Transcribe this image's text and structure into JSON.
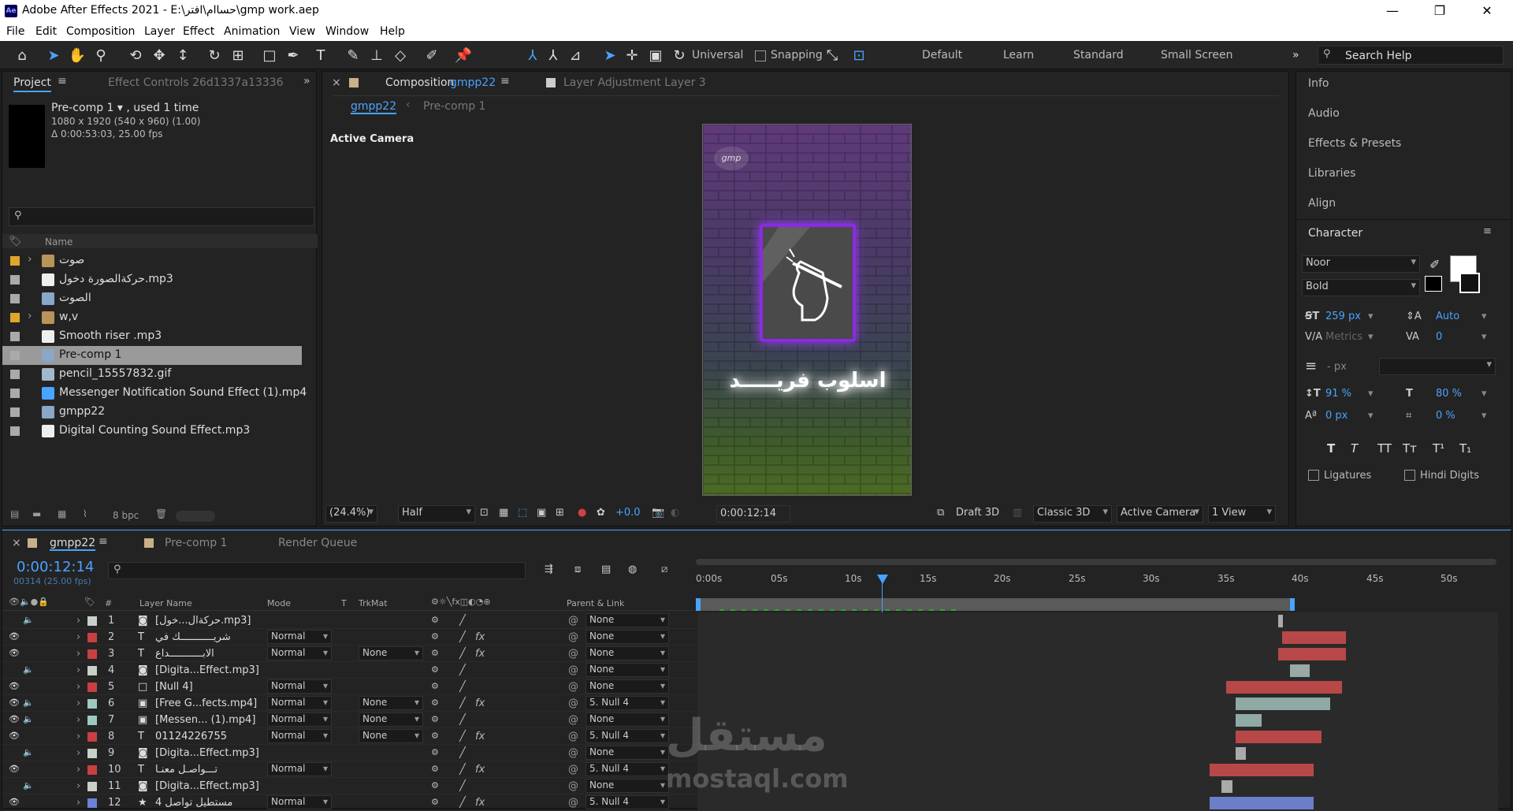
{
  "titlebar": {
    "app_icon": "Ae",
    "title": "Adobe After Effects 2021 - E:\\حساام\\افتر\\gmp work.aep",
    "minimize": "—",
    "maximize": "❐",
    "close": "✕"
  },
  "menu": [
    "File",
    "Edit",
    "Composition",
    "Layer",
    "Effect",
    "Animation",
    "View",
    "Window",
    "Help"
  ],
  "toolbar": {
    "axis_mode": "Universal",
    "snapping": "Snapping",
    "workspaces": [
      "Default",
      "Learn",
      "Standard",
      "Small Screen"
    ],
    "search_placeholder": "Search Help"
  },
  "project": {
    "tab": "Project",
    "effect_tab": "Effect Controls 26d1337a13336",
    "preview_name": "Pre-comp 1 ▾ , used 1 time",
    "preview_info1": "1080 x 1920  (540 x 960) (1.00)",
    "preview_info2": "Δ 0:00:53:03, 25.00 fps",
    "col_name": "Name",
    "bpc": "8 bpc",
    "items": [
      {
        "name": "صوت",
        "type": "folder",
        "color": "#e0a52a"
      },
      {
        "name": "حركةالصورة دخول.mp3",
        "type": "audio",
        "color": "#aaaaaa"
      },
      {
        "name": "الصوت",
        "type": "comp",
        "color": "#aaaaaa"
      },
      {
        "name": "w,v",
        "type": "folder",
        "color": "#e0a52a"
      },
      {
        "name": "Smooth riser .mp3",
        "type": "audio",
        "color": "#aaaaaa"
      },
      {
        "name": "Pre-comp 1",
        "type": "comp",
        "color": "#aaaaaa"
      },
      {
        "name": "pencil_15557832.gif",
        "type": "image",
        "color": "#aaaaaa"
      },
      {
        "name": "Messenger Notification Sound Effect (1).mp4",
        "type": "video",
        "color": "#aaaaaa"
      },
      {
        "name": "gmpp22",
        "type": "comp",
        "color": "#aaaaaa"
      },
      {
        "name": "Digital Counting Sound Effect.mp3",
        "type": "audio",
        "color": "#aaaaaa"
      }
    ]
  },
  "comp": {
    "tab_prefix": "Composition",
    "tab_name": "gmpp22",
    "layer_tab": "Layer  Adjustment Layer 3",
    "crumbs": [
      "gmpp22",
      "Pre-comp 1"
    ],
    "camera_label": "Active Camera",
    "logo_text": "gmp",
    "arabic_text": "اسلوب فريـــــد",
    "zoom": "(24.4%)",
    "resolution": "Half",
    "exposure": "+0.0",
    "timecode": "0:00:12:14",
    "draft": "Draft 3D",
    "renderer": "Classic 3D",
    "view_camera": "Active Camera",
    "views": "1 View"
  },
  "right_panel": {
    "items": [
      "Info",
      "Audio",
      "Effects & Presets",
      "Libraries",
      "Align"
    ],
    "character": "Character",
    "font": "Noor",
    "style": "Bold",
    "size": "259 px",
    "leading": "Auto",
    "kerning": "Metrics",
    "tracking": "0",
    "stroke": "- px",
    "vscale": "91 %",
    "hscale": "80 %",
    "baseline": "0 px",
    "tsume": "0 %",
    "ligatures": "Ligatures",
    "hindi": "Hindi Digits"
  },
  "timeline": {
    "tabs": [
      "gmpp22",
      "Pre-comp 1",
      "Render Queue"
    ],
    "timecode": "0:00:12:14",
    "frames": "00314 (25.00 fps)",
    "headers": {
      "num": "#",
      "name": "Layer Name",
      "mode": "Mode",
      "t": "T",
      "trkmat": "TrkMat",
      "parent": "Parent & Link"
    },
    "ruler": [
      "0:00s",
      "05s",
      "10s",
      "15s",
      "20s",
      "25s",
      "30s",
      "35s",
      "40s",
      "45s",
      "50s"
    ],
    "layers": [
      {
        "n": "1",
        "name": "[حركةال...خول.mp3]",
        "type": "audio",
        "color": "#c8d0c8",
        "mode": "",
        "trk": "",
        "parent": "None",
        "fx": false,
        "bar": [
          0.725,
          0.73
        ],
        "barc": "#aaaaaa"
      },
      {
        "n": "2",
        "name": "شريـــــــــــك في",
        "type": "text",
        "color": "#c94040",
        "mode": "Normal",
        "trk": "",
        "parent": "None",
        "fx": true,
        "bar": [
          0.73,
          0.81
        ],
        "barc": "#b84848"
      },
      {
        "n": "3",
        "name": "الابـــــــــــداع",
        "type": "text",
        "color": "#c94040",
        "mode": "Normal",
        "trk": "None",
        "parent": "None",
        "fx": true,
        "bar": [
          0.725,
          0.81
        ],
        "barc": "#b84848"
      },
      {
        "n": "4",
        "name": "[Digita...Effect.mp3]",
        "type": "audio",
        "color": "#c8d0c8",
        "mode": "",
        "trk": "",
        "parent": "None",
        "fx": false,
        "bar": [
          0.74,
          0.765
        ],
        "barc": "#97aaa5"
      },
      {
        "n": "5",
        "name": "[Null 4]",
        "type": "null",
        "color": "#c94040",
        "mode": "Normal",
        "trk": "",
        "parent": "None",
        "fx": false,
        "bar": [
          0.66,
          0.805
        ],
        "barc": "#b84848"
      },
      {
        "n": "6",
        "name": "[Free G...fects.mp4]",
        "type": "video",
        "color": "#9fc9c0",
        "mode": "Normal",
        "trk": "None",
        "parent": "5. Null 4",
        "fx": true,
        "bar": [
          0.672,
          0.79
        ],
        "barc": "#8fa9a4"
      },
      {
        "n": "7",
        "name": "[Messen... (1).mp4]",
        "type": "video",
        "color": "#9fc9c0",
        "mode": "Normal",
        "trk": "None",
        "parent": "None",
        "fx": false,
        "bar": [
          0.672,
          0.705
        ],
        "barc": "#8fa9a4"
      },
      {
        "n": "8",
        "name": "01124226755",
        "type": "text",
        "color": "#c94040",
        "mode": "Normal",
        "trk": "None",
        "parent": "5. Null 4",
        "fx": true,
        "bar": [
          0.672,
          0.78
        ],
        "barc": "#b84848"
      },
      {
        "n": "9",
        "name": "[Digita...Effect.mp3]",
        "type": "audio",
        "color": "#c8d0c8",
        "mode": "",
        "trk": "",
        "parent": "None",
        "fx": false,
        "bar": [
          0.672,
          0.685
        ],
        "barc": "#aaaaaa"
      },
      {
        "n": "10",
        "name": "تـــواصـل معنـا",
        "type": "text",
        "color": "#c94040",
        "mode": "Normal",
        "trk": "",
        "parent": "5. Null 4",
        "fx": true,
        "bar": [
          0.64,
          0.77
        ],
        "barc": "#b84848"
      },
      {
        "n": "11",
        "name": "[Digita...Effect.mp3]",
        "type": "audio",
        "color": "#c8d0c8",
        "mode": "",
        "trk": "",
        "parent": "None",
        "fx": false,
        "bar": [
          0.655,
          0.668
        ],
        "barc": "#aaaaaa"
      },
      {
        "n": "12",
        "name": "مستطيل تواصل 4",
        "type": "shape",
        "color": "#6a82d8",
        "mode": "Normal",
        "trk": "",
        "parent": "5. Null 4",
        "fx": true,
        "bar": [
          0.64,
          0.77
        ],
        "barc": "#6a7fc7"
      }
    ]
  },
  "watermark": {
    "ar": "مستقل",
    "en": "mostaql.com"
  }
}
